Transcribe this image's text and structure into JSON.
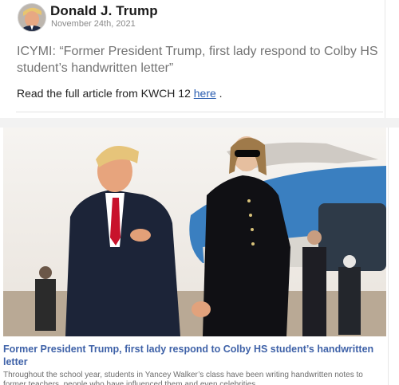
{
  "post": {
    "author": "Donald J. Trump",
    "date": "November 24th, 2021",
    "headline": "ICYMI: “Former President Trump, first lady respond to Colby HS student’s handwritten letter”",
    "body_prefix": "Read the full article from KWCH 12 ",
    "link_text": "here",
    "body_suffix": " ."
  },
  "link_preview": {
    "title": "Former President Trump, first lady respond to Colby HS student’s handwritten letter",
    "snippet": "Throughout the school year, students in Yancey Walker’s class have been writing handwritten notes to former teachers, people who have influenced them and even celebrities."
  }
}
